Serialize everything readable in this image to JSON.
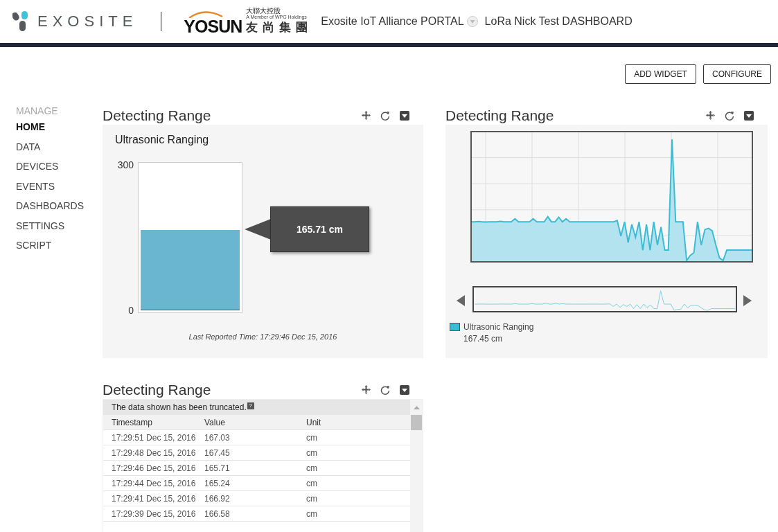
{
  "header": {
    "brand": "EXOSITE",
    "partner": {
      "name": "YOSUN",
      "chinese": "友尚集團",
      "parent": "大聯大控股",
      "tagline": "A Member of WPG Holdings"
    },
    "portal": "Exosite IoT Alliance PORTAL",
    "dashboard": "LoRa Nick Test DASHBOARD"
  },
  "actions": [
    "ADD WIDGET",
    "CONFIGURE"
  ],
  "sidebar": {
    "heading": "MANAGE",
    "items": [
      {
        "label": "HOME",
        "selected": true
      },
      {
        "label": "DATA",
        "selected": false
      },
      {
        "label": "DEVICES",
        "selected": false
      },
      {
        "label": "EVENTS",
        "selected": false
      },
      {
        "label": "DASHBOARDS",
        "selected": false
      },
      {
        "label": "SETTINGS",
        "selected": false
      },
      {
        "label": "SCRIPT",
        "selected": false
      }
    ]
  },
  "widgets": [
    {
      "kind": "gauge",
      "title": "Detecting Range",
      "subtitle": "Ultrasonic Ranging",
      "max": "300",
      "min": "0",
      "level": 0.552,
      "reading": "165.71 cm",
      "footer": "Last Reported Time: 17:29:46 Dec 15, 2016"
    },
    {
      "kind": "graph",
      "title": "Detecting Range",
      "legend": {
        "name": "Ultrasonic Ranging",
        "color": "#3bbcd4",
        "reading": "167.45 cm"
      }
    },
    {
      "kind": "table",
      "title": "Detecting Range",
      "notice": "The data shown has been truncated.",
      "help": "?",
      "columns": [
        "Timestamp",
        "Value",
        "Unit"
      ],
      "rows": [
        [
          "17:29:51 Dec 15, 2016",
          "167.03",
          "cm"
        ],
        [
          "17:29:48 Dec 15, 2016",
          "167.45",
          "cm"
        ],
        [
          "17:29:46 Dec 15, 2016",
          "165.71",
          "cm"
        ],
        [
          "17:29:44 Dec 15, 2016",
          "165.24",
          "cm"
        ],
        [
          "17:29:41 Dec 15, 2016",
          "166.92",
          "cm"
        ],
        [
          "17:29:39 Dec 15, 2016",
          "166.58",
          "cm"
        ]
      ]
    }
  ]
}
